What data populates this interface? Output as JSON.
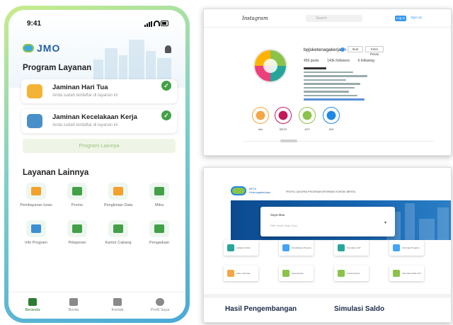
{
  "phone": {
    "status_time": "9:41",
    "brand": "JMO",
    "section_program": "Program Layanan",
    "programs": [
      {
        "title": "Jaminan Hari Tua",
        "subtitle": "Anda sudah terdaftar di layanan ini",
        "color": "#f5b335"
      },
      {
        "title": "Jaminan Kecelakaan Kerja",
        "subtitle": "Anda sudah terdaftar di layanan ini",
        "color": "#4a90c8"
      }
    ],
    "button_lainnya": "Program Lainnya",
    "section_lainnya": "Layanan Lainnya",
    "services": [
      {
        "label": "Pembayaran Iuran",
        "color": "#f3a12c"
      },
      {
        "label": "Promo",
        "color": "#43a047"
      },
      {
        "label": "Pengkinian Data",
        "color": "#f3a12c"
      },
      {
        "label": "Mitra",
        "color": "#43a047"
      },
      {
        "label": "Info Program",
        "color": "#3b8fd4"
      },
      {
        "label": "Pelaporan",
        "color": "#43a047"
      },
      {
        "label": "Kantor Cabang",
        "color": "#43a047"
      },
      {
        "label": "Pengaduan",
        "color": "#43a047"
      }
    ],
    "nav": [
      {
        "label": "Beranda",
        "active": true
      },
      {
        "label": "Berita",
        "active": false
      },
      {
        "label": "Kontak",
        "active": false
      },
      {
        "label": "Profil Saya",
        "active": false
      }
    ]
  },
  "instagram": {
    "brand": "Instagram",
    "search_placeholder": "Search",
    "login": "Log In",
    "signup": "Sign Up",
    "username": "bpjsketenagakerjaan",
    "button_1": "Ikuti",
    "button_2": "Kirim Pesan",
    "stats": [
      "459 posts",
      "143k followers",
      "6 following"
    ],
    "highlights": [
      {
        "label": "Info",
        "color": "#f4a742"
      },
      {
        "label": "BPJS",
        "color": "#c2185b"
      },
      {
        "label": "JHT",
        "color": "#8bc34a"
      },
      {
        "label": "JKK",
        "color": "#1e88e5"
      }
    ]
  },
  "website": {
    "logo_text": "BPJS Ketenagakerjaan",
    "nav_text": "PROFIL  CAKUPAN  PROGRAM  INFORMASI  KONTAK  BERITA",
    "panel_label": "Saya Mau",
    "panel_select": "Pilih Salah Satu Opsi",
    "services": [
      {
        "label": "Aplikasi Online",
        "color": "#26a69a"
      },
      {
        "label": "Pendaftaran Peserta",
        "color": "#42a5f5"
      },
      {
        "label": "Pencairan JHT",
        "color": "#26a69a"
      },
      {
        "label": "Informasi Program",
        "color": "#42a5f5"
      },
      {
        "label": "Klaim Jaminan",
        "color": "#f4a742"
      },
      {
        "label": "Kepesertaan",
        "color": "#8bc34a"
      },
      {
        "label": "Lokasi Kantor",
        "color": "#8bc34a"
      },
      {
        "label": "Informasi Saldo JHT",
        "color": "#8bc34a"
      }
    ],
    "heading_1": "Hasil Pengembangan",
    "heading_2": "Simulasi Saldo"
  }
}
